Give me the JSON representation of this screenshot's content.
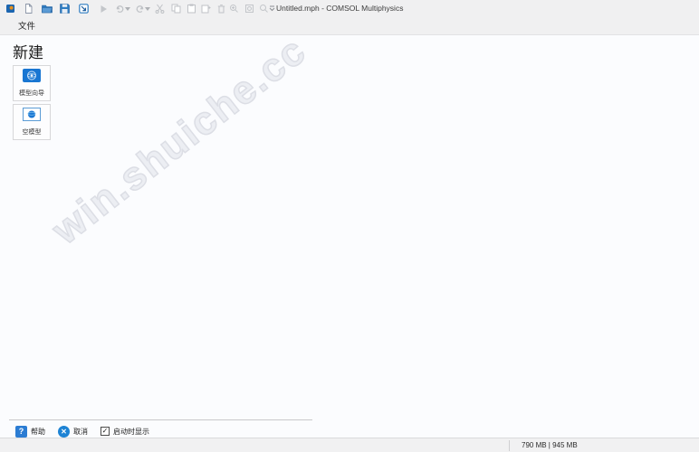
{
  "window": {
    "title": "Untitled.mph - COMSOL Multiphysics"
  },
  "menu": {
    "file_label": "文件"
  },
  "toolbar": {
    "icons": [
      "app-logo",
      "new-file",
      "open-file",
      "save",
      "save-as",
      "run",
      "undo",
      "undo-dropdown",
      "redo",
      "redo-dropdown",
      "cut",
      "copy",
      "paste",
      "duplicate",
      "delete",
      "zoom-in",
      "zoom-extents",
      "zoom-box",
      "toolbar-overflow"
    ]
  },
  "dialog": {
    "heading": "新建",
    "options": [
      {
        "id": "model-wizard",
        "label": "模型向导"
      },
      {
        "id": "blank-model",
        "label": "空模型"
      }
    ],
    "footer": {
      "help_label": "帮助",
      "help_glyph": "?",
      "cancel_label": "取消",
      "cancel_glyph": "✕",
      "show_on_startup_label": "启动时显示",
      "show_on_startup_checked": true,
      "checkbox_glyph": "✓"
    }
  },
  "watermark": {
    "text": "win.shuiche.cc"
  },
  "status_bar": {
    "memory": "790 MB | 945 MB"
  },
  "colors": {
    "accent_blue": "#2b7cd3",
    "toolbar_blue": "#2e7cc1",
    "disabled_gray": "#bfc2c6",
    "chrome_gray": "#f0f0f1"
  }
}
